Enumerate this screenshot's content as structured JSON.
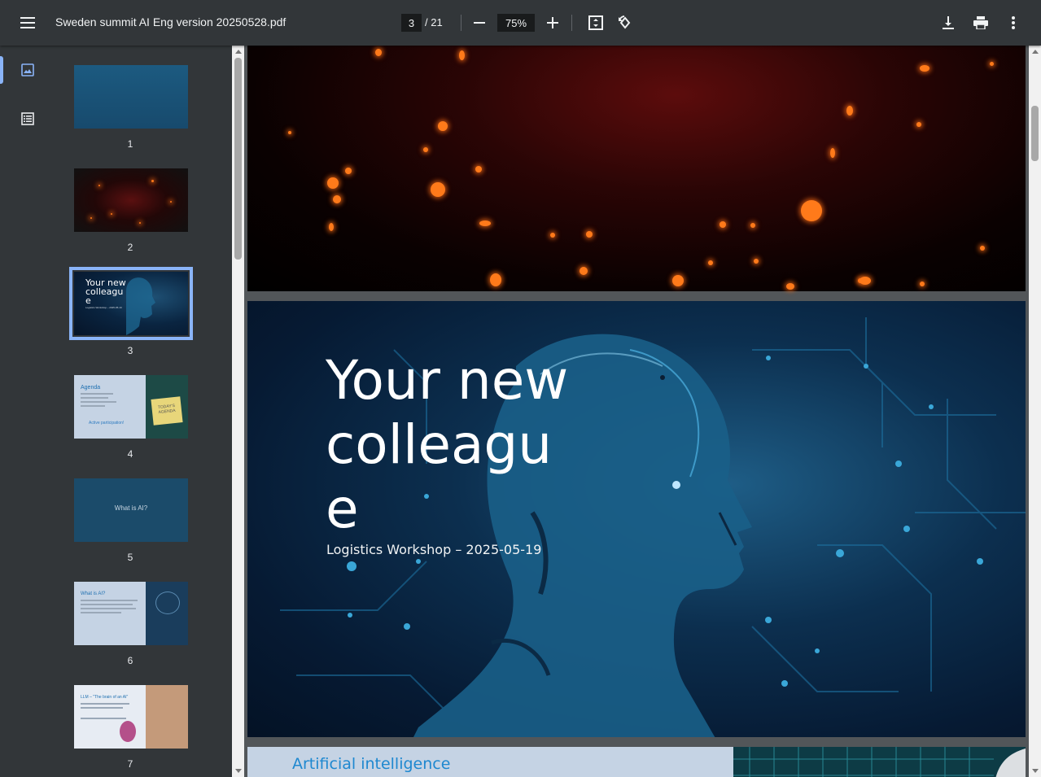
{
  "toolbar": {
    "menu_icon": "hamburger-menu-icon",
    "title": "Sweden summit AI Eng version 20250528.pdf",
    "page_current": "3",
    "page_total": "/ 21",
    "zoom": "75%",
    "icons": [
      "zoom-out-icon",
      "zoom-in-icon",
      "fit-page-icon",
      "rotate-icon",
      "download-icon",
      "print-icon",
      "more-vert-icon"
    ]
  },
  "rail": {
    "items": [
      "thumbnails-icon",
      "outline-icon"
    ]
  },
  "thumbnails": [
    {
      "number": "1"
    },
    {
      "number": "2"
    },
    {
      "number": "3",
      "selected": true,
      "title": "Your new colleagu e",
      "subtitle": "Logistics Workshop – 2025-05-19"
    },
    {
      "number": "4",
      "heading": "Agenda",
      "caption": "Active participation!",
      "note": "TODAY'S AGENDA"
    },
    {
      "number": "5",
      "heading": "What is AI?"
    },
    {
      "number": "6",
      "heading": "What is AI?"
    },
    {
      "number": "7",
      "heading": "LLM – \"The brain of an AI\""
    }
  ],
  "slides": {
    "current": {
      "title": "Your new colleagu e",
      "subtitle": "Logistics Workshop – 2025-05-19"
    },
    "next": {
      "title": "Artificial intelligence"
    }
  },
  "colors": {
    "toolbar": "#323639",
    "viewer_bg": "#525659",
    "accent": "#8ab4f8"
  }
}
